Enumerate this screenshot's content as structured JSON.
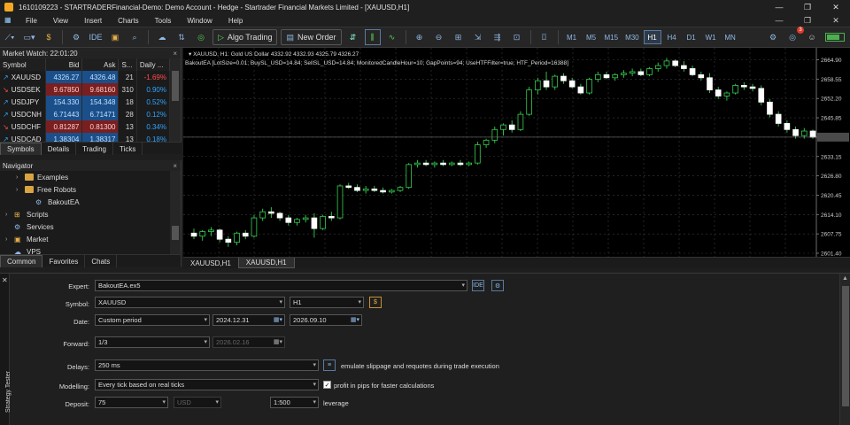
{
  "window": {
    "title": "1610109223 - STARTRADERFinancial-Demo: Demo Account - Hedge - Startrader Financial Markets Limited - [XAUUSD,H1]"
  },
  "menu": [
    "File",
    "View",
    "Insert",
    "Charts",
    "Tools",
    "Window",
    "Help"
  ],
  "toolbar": {
    "ide_label": "IDE",
    "algo_trading_label": "Algo Trading",
    "new_order_label": "New Order",
    "timeframes": [
      "M1",
      "M5",
      "M15",
      "M30",
      "H1",
      "H4",
      "D1",
      "W1",
      "MN"
    ],
    "active_timeframe": "H1",
    "notification_count": "3"
  },
  "market_watch": {
    "title": "Market Watch: 22:01:20",
    "columns": [
      "Symbol",
      "Bid",
      "Ask",
      "S...",
      "Daily ..."
    ],
    "rows": [
      {
        "symbol": "XAUUSD",
        "dir": "up",
        "bid": "4326.27",
        "ask": "4326.48",
        "spread": "21",
        "daily": "-1.69%",
        "daily_dir": "dn"
      },
      {
        "symbol": "USDSEK",
        "dir": "dn",
        "bid": "9.67850",
        "ask": "9.68160",
        "spread": "310",
        "daily": "0.90%",
        "daily_dir": "up"
      },
      {
        "symbol": "USDJPY",
        "dir": "up",
        "bid": "154.330",
        "ask": "154.348",
        "spread": "18",
        "daily": "0.52%",
        "daily_dir": "up"
      },
      {
        "symbol": "USDCNH",
        "dir": "up",
        "bid": "6.71443",
        "ask": "6.71471",
        "spread": "28",
        "daily": "0.12%",
        "daily_dir": "up"
      },
      {
        "symbol": "USDCHF",
        "dir": "dn",
        "bid": "0.81287",
        "ask": "0.81300",
        "spread": "13",
        "daily": "0.34%",
        "daily_dir": "up"
      },
      {
        "symbol": "USDCAD",
        "dir": "up",
        "bid": "1.38304",
        "ask": "1.38317",
        "spread": "13",
        "daily": "0.18%",
        "daily_dir": "up"
      }
    ],
    "tabs": [
      "Symbols",
      "Details",
      "Trading",
      "Ticks"
    ],
    "active_tab": "Symbols"
  },
  "navigator": {
    "title": "Navigator",
    "items": [
      {
        "label": "Examples",
        "type": "folder",
        "indent": 1,
        "chev": "›"
      },
      {
        "label": "Free Robots",
        "type": "folder",
        "indent": 1,
        "chev": "›"
      },
      {
        "label": "BakoutEA",
        "type": "ea",
        "indent": 2,
        "chev": ""
      },
      {
        "label": "Scripts",
        "type": "scripts",
        "indent": 0,
        "chev": "›"
      },
      {
        "label": "Services",
        "type": "services",
        "indent": 0,
        "chev": ""
      },
      {
        "label": "Market",
        "type": "market",
        "indent": 0,
        "chev": "›"
      },
      {
        "label": "VPS",
        "type": "vps",
        "indent": 0,
        "chev": ""
      }
    ],
    "tabs": [
      "Common",
      "Favorites",
      "Chats"
    ],
    "active_tab": "Common"
  },
  "chart": {
    "header": "XAUUSD, H1:  Gold US Dollar  4332.92  4332.93  4325.79  4326.27",
    "ea_info": "BakoutEA [LotSize=0.01; BuySL_USD=14.84; SellSL_USD=14.84; MonitoredCandleHour=10; GapPoints=94; UseHTFFilter=true; HTF_Period=16388]",
    "price_labels": [
      "2664.90",
      "2658.55",
      "2652.20",
      "2645.85",
      "2639.50",
      "2633.15",
      "2626.80",
      "2620.45",
      "2614.10",
      "2607.75",
      "2601.40"
    ],
    "current_price": "2639.50",
    "tabs": [
      "XAUUSD,H1",
      "XAUUSD,H1"
    ],
    "active_tab": 1
  },
  "chart_data": {
    "type": "candlestick",
    "ylim": [
      2601.4,
      2666.5
    ],
    "candles": [
      [
        2608.0,
        2609.5,
        2606.0,
        2607.0
      ],
      [
        2607.0,
        2609.0,
        2605.5,
        2608.5
      ],
      [
        2608.5,
        2610.0,
        2607.0,
        2609.0
      ],
      [
        2609.0,
        2609.5,
        2605.0,
        2606.0
      ],
      [
        2606.0,
        2607.0,
        2603.5,
        2605.0
      ],
      [
        2605.0,
        2608.5,
        2604.0,
        2608.0
      ],
      [
        2608.0,
        2609.0,
        2606.0,
        2607.0
      ],
      [
        2607.0,
        2614.0,
        2606.5,
        2613.0
      ],
      [
        2613.0,
        2616.0,
        2612.0,
        2615.0
      ],
      [
        2615.0,
        2616.5,
        2613.0,
        2614.5
      ],
      [
        2614.5,
        2615.0,
        2612.0,
        2613.0
      ],
      [
        2613.0,
        2614.0,
        2610.5,
        2611.5
      ],
      [
        2611.5,
        2613.0,
        2610.5,
        2612.5
      ],
      [
        2612.5,
        2614.0,
        2611.5,
        2613.0
      ],
      [
        2613.0,
        2614.5,
        2606.5,
        2609.5
      ],
      [
        2609.5,
        2614.0,
        2609.0,
        2613.5
      ],
      [
        2613.5,
        2615.0,
        2612.0,
        2613.0
      ],
      [
        2613.0,
        2624.0,
        2612.5,
        2623.5
      ],
      [
        2623.5,
        2624.5,
        2622.5,
        2623.0
      ],
      [
        2623.0,
        2624.0,
        2621.5,
        2622.0
      ],
      [
        2622.0,
        2623.5,
        2621.0,
        2622.5
      ],
      [
        2622.5,
        2623.5,
        2621.5,
        2622.0
      ],
      [
        2622.0,
        2623.0,
        2621.0,
        2621.5
      ],
      [
        2621.5,
        2622.5,
        2621.0,
        2622.0
      ],
      [
        2622.0,
        2623.5,
        2621.5,
        2623.0
      ],
      [
        2623.0,
        2631.0,
        2622.5,
        2630.5
      ],
      [
        2630.5,
        2632.0,
        2629.5,
        2631.0
      ],
      [
        2631.0,
        2632.0,
        2630.0,
        2630.5
      ],
      [
        2630.5,
        2631.5,
        2629.5,
        2631.0
      ],
      [
        2631.0,
        2632.0,
        2630.0,
        2630.5
      ],
      [
        2630.5,
        2631.5,
        2630.0,
        2631.0
      ],
      [
        2631.0,
        2632.0,
        2630.0,
        2630.5
      ],
      [
        2630.5,
        2631.5,
        2630.0,
        2631.0
      ],
      [
        2631.0,
        2638.0,
        2630.5,
        2637.0
      ],
      [
        2637.0,
        2639.0,
        2636.0,
        2638.5
      ],
      [
        2638.5,
        2643.0,
        2637.5,
        2642.0
      ],
      [
        2642.0,
        2644.0,
        2640.0,
        2643.5
      ],
      [
        2643.5,
        2645.0,
        2641.0,
        2642.0
      ],
      [
        2642.0,
        2648.0,
        2641.5,
        2647.0
      ],
      [
        2647.0,
        2656.0,
        2646.5,
        2655.0
      ],
      [
        2655.0,
        2659.0,
        2653.5,
        2658.0
      ],
      [
        2658.0,
        2661.0,
        2655.0,
        2656.0
      ],
      [
        2656.0,
        2660.0,
        2655.0,
        2659.5
      ],
      [
        2659.5,
        2660.5,
        2657.0,
        2658.0
      ],
      [
        2658.0,
        2659.0,
        2655.5,
        2656.0
      ],
      [
        2656.0,
        2657.0,
        2653.5,
        2654.0
      ],
      [
        2654.0,
        2659.0,
        2653.5,
        2658.5
      ],
      [
        2658.5,
        2661.0,
        2657.5,
        2660.0
      ],
      [
        2660.0,
        2661.0,
        2658.5,
        2659.0
      ],
      [
        2659.0,
        2660.5,
        2658.0,
        2660.0
      ],
      [
        2660.0,
        2661.5,
        2659.0,
        2660.5
      ],
      [
        2660.5,
        2662.0,
        2659.5,
        2661.0
      ],
      [
        2661.0,
        2662.0,
        2659.5,
        2660.0
      ],
      [
        2660.0,
        2662.5,
        2659.5,
        2662.0
      ],
      [
        2662.0,
        2664.0,
        2661.0,
        2663.0
      ],
      [
        2663.0,
        2665.5,
        2662.0,
        2664.5
      ],
      [
        2664.5,
        2665.0,
        2662.5,
        2663.0
      ],
      [
        2663.0,
        2664.5,
        2661.0,
        2662.0
      ],
      [
        2662.0,
        2663.0,
        2659.5,
        2660.0
      ],
      [
        2660.0,
        2661.0,
        2658.0,
        2659.0
      ],
      [
        2659.0,
        2660.5,
        2654.0,
        2655.0
      ],
      [
        2655.0,
        2656.0,
        2652.0,
        2653.0
      ],
      [
        2653.0,
        2654.5,
        2651.5,
        2654.0
      ],
      [
        2654.0,
        2657.0,
        2653.5,
        2656.5
      ],
      [
        2656.5,
        2657.5,
        2655.0,
        2656.0
      ],
      [
        2656.0,
        2657.0,
        2654.5,
        2655.5
      ],
      [
        2655.5,
        2656.5,
        2650.0,
        2651.0
      ],
      [
        2651.0,
        2652.0,
        2646.0,
        2647.0
      ],
      [
        2647.0,
        2648.0,
        2643.0,
        2644.0
      ],
      [
        2644.0,
        2645.0,
        2641.0,
        2642.0
      ],
      [
        2642.0,
        2643.0,
        2639.0,
        2640.0
      ],
      [
        2640.0,
        2642.5,
        2639.0,
        2641.5
      ],
      [
        2641.5,
        2642.0,
        2639.0,
        2639.5
      ]
    ]
  },
  "tester": {
    "side_label": "Strategy Tester",
    "expert_label": "Expert:",
    "expert_value": "BakoutEA.ex5",
    "symbol_label": "Symbol:",
    "symbol_value": "XAUUSD",
    "period_value": "H1",
    "date_label": "Date:",
    "date_mode": "Custom period",
    "date_from": "2024.12.31",
    "date_to": "2026.09.10",
    "forward_label": "Forward:",
    "forward_value": "1/3",
    "forward_date": "2026.02.16",
    "delays_label": "Delays:",
    "delays_value": "250 ms",
    "delays_text": "emulate slippage and requotes during trade execution",
    "modelling_label": "Modelling:",
    "modelling_value": "Every tick based on real ticks",
    "profit_pips_text": "profit in pips for faster calculations",
    "deposit_label": "Deposit:",
    "deposit_value": "75",
    "currency_value": "USD",
    "leverage_value": "1:500",
    "leverage_label": "leverage"
  }
}
